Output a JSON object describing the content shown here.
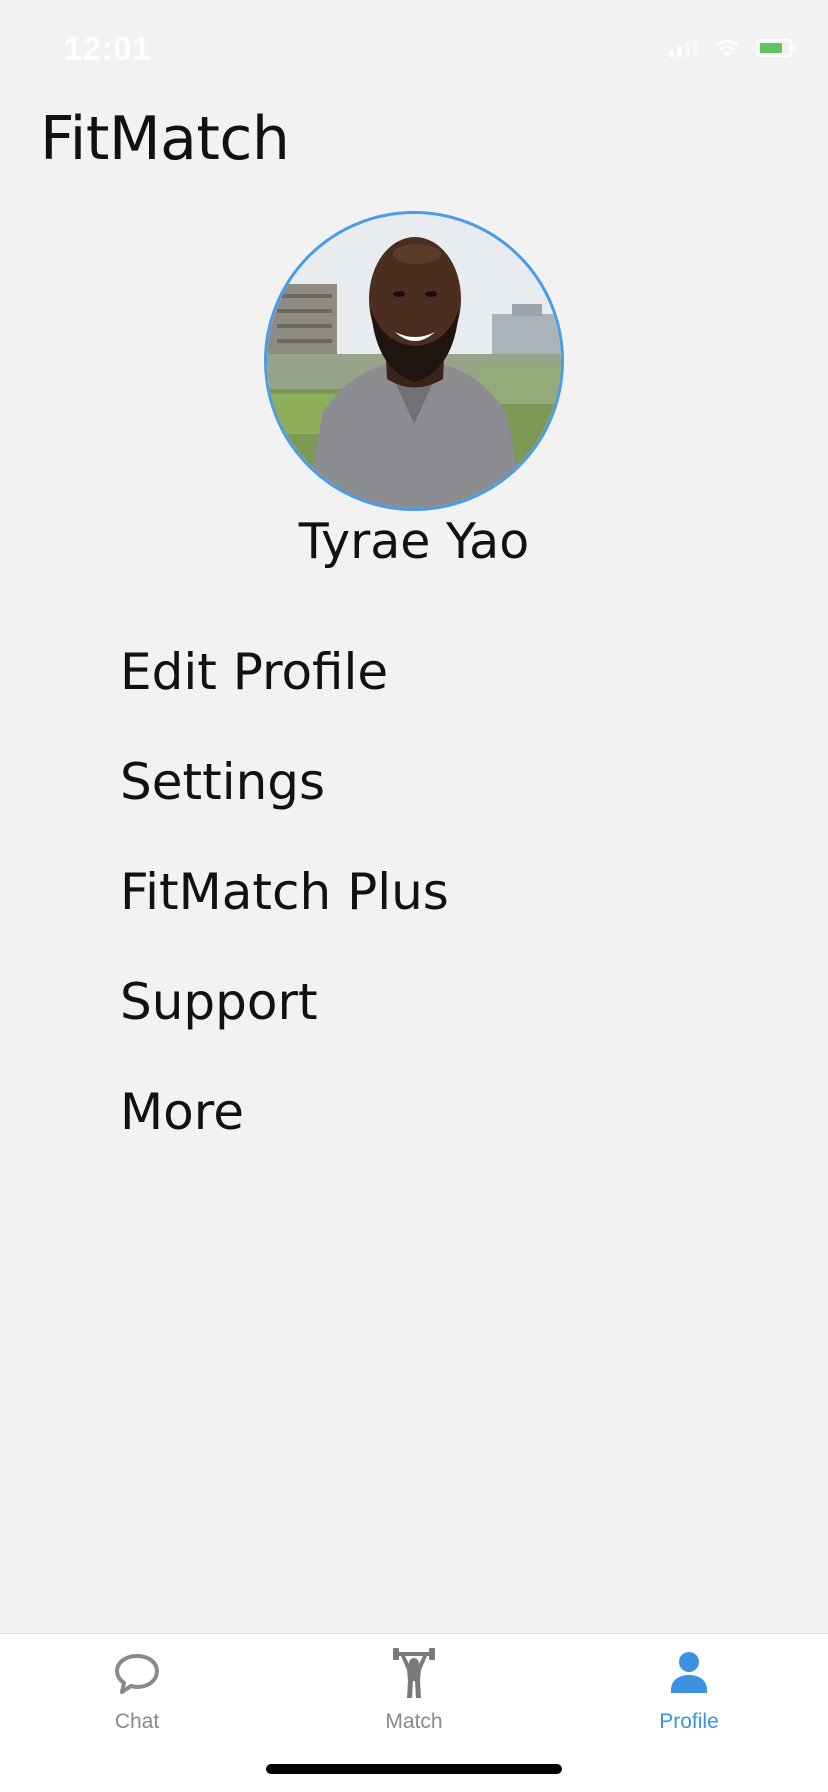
{
  "status_bar": {
    "time": "12:01"
  },
  "app": {
    "title": "FitMatch"
  },
  "profile": {
    "name": "Tyrae Yao",
    "avatar_ring_color": "#4a9be8"
  },
  "menu": {
    "items": [
      {
        "label": "Edit Profile"
      },
      {
        "label": "Settings"
      },
      {
        "label": "FitMatch Plus"
      },
      {
        "label": "Support"
      },
      {
        "label": "More"
      }
    ]
  },
  "tab_bar": {
    "tabs": [
      {
        "label": "Chat",
        "icon": "chat-bubble-icon",
        "active": false
      },
      {
        "label": "Match",
        "icon": "weightlifter-icon",
        "active": false
      },
      {
        "label": "Profile",
        "icon": "person-icon",
        "active": true
      }
    ],
    "active_color": "#3b92e0",
    "inactive_color": "#8a8a8a"
  }
}
